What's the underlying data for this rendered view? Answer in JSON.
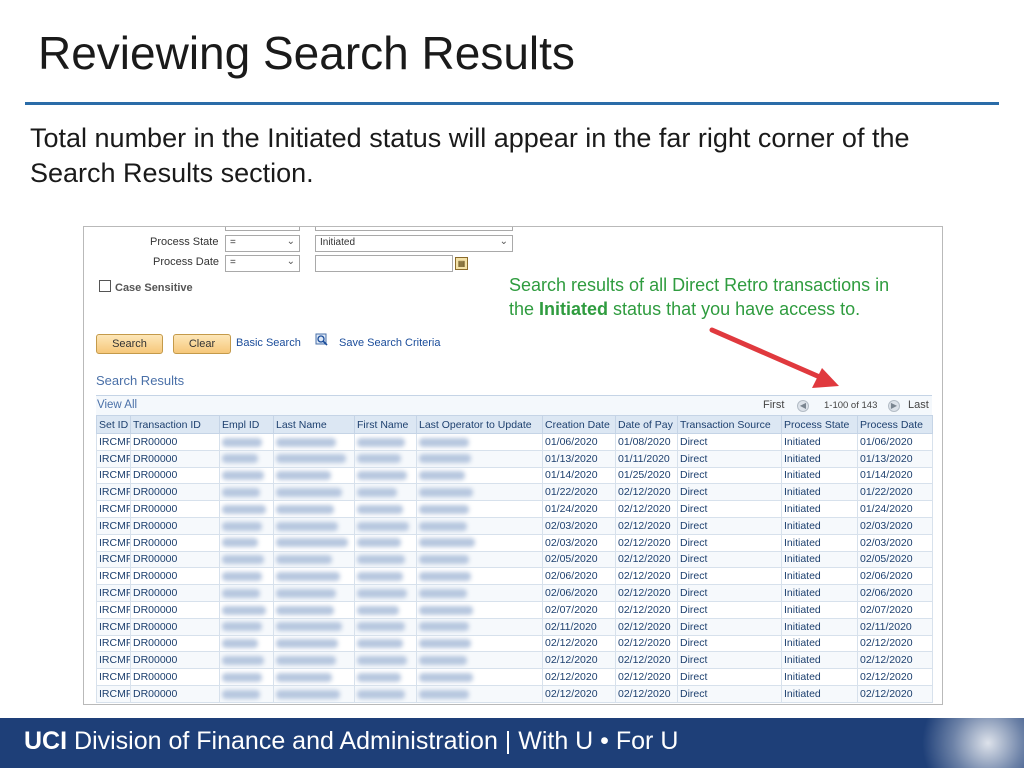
{
  "slide": {
    "title": "Reviewing Search Results",
    "body": "Total number in the Initiated status will appear in the far right corner of the Search Results section."
  },
  "criteria": {
    "process_state_label": "Process State",
    "process_state_operator": "=",
    "process_state_value": "Initiated",
    "process_date_label": "Process Date",
    "process_date_operator": "=",
    "process_date_value": "",
    "case_sensitive_label": "Case Sensitive",
    "case_sensitive_checked": false
  },
  "actions": {
    "search": "Search",
    "clear": "Clear",
    "basic_search": "Basic Search",
    "save_search_criteria": "Save Search Criteria"
  },
  "callout": {
    "before": "Search results of all Direct Retro transactions in the ",
    "highlight": "Initiated",
    "after": " status that you have access to.",
    "color": "#2f9c3f",
    "arrow_color": "#e0393e"
  },
  "results": {
    "section_title": "Search Results",
    "view_all": "View All",
    "first": "First",
    "range": "1-100 of 143",
    "last": "Last",
    "columns": [
      "Set ID",
      "Transaction ID",
      "Empl ID",
      "Last Name",
      "First Name",
      "Last Operator to Update",
      "Creation Date",
      "Date of Pay",
      "Transaction Source",
      "Process State",
      "Process Date"
    ],
    "rows": [
      [
        "IRCMP",
        "DR00000",
        "01/06/2020",
        "01/08/2020",
        "Direct",
        "Initiated",
        "01/06/2020"
      ],
      [
        "IRCMP",
        "DR00000",
        "01/13/2020",
        "01/11/2020",
        "Direct",
        "Initiated",
        "01/13/2020"
      ],
      [
        "IRCMP",
        "DR00000",
        "01/14/2020",
        "01/25/2020",
        "Direct",
        "Initiated",
        "01/14/2020"
      ],
      [
        "IRCMP",
        "DR00000",
        "01/22/2020",
        "02/12/2020",
        "Direct",
        "Initiated",
        "01/22/2020"
      ],
      [
        "IRCMP",
        "DR00000",
        "01/24/2020",
        "02/12/2020",
        "Direct",
        "Initiated",
        "01/24/2020"
      ],
      [
        "IRCMP",
        "DR00000",
        "02/03/2020",
        "02/12/2020",
        "Direct",
        "Initiated",
        "02/03/2020"
      ],
      [
        "IRCMP",
        "DR00000",
        "02/03/2020",
        "02/12/2020",
        "Direct",
        "Initiated",
        "02/03/2020"
      ],
      [
        "IRCMP",
        "DR00000",
        "02/05/2020",
        "02/12/2020",
        "Direct",
        "Initiated",
        "02/05/2020"
      ],
      [
        "IRCMP",
        "DR00000",
        "02/06/2020",
        "02/12/2020",
        "Direct",
        "Initiated",
        "02/06/2020"
      ],
      [
        "IRCMP",
        "DR00000",
        "02/06/2020",
        "02/12/2020",
        "Direct",
        "Initiated",
        "02/06/2020"
      ],
      [
        "IRCMP",
        "DR00000",
        "02/07/2020",
        "02/12/2020",
        "Direct",
        "Initiated",
        "02/07/2020"
      ],
      [
        "IRCMP",
        "DR00000",
        "02/11/2020",
        "02/12/2020",
        "Direct",
        "Initiated",
        "02/11/2020"
      ],
      [
        "IRCMP",
        "DR00000",
        "02/12/2020",
        "02/12/2020",
        "Direct",
        "Initiated",
        "02/12/2020"
      ],
      [
        "IRCMP",
        "DR00000",
        "02/12/2020",
        "02/12/2020",
        "Direct",
        "Initiated",
        "02/12/2020"
      ],
      [
        "IRCMP",
        "DR00000",
        "02/12/2020",
        "02/12/2020",
        "Direct",
        "Initiated",
        "02/12/2020"
      ],
      [
        "IRCMP",
        "DR00000",
        "02/12/2020",
        "02/12/2020",
        "Direct",
        "Initiated",
        "02/12/2020"
      ]
    ]
  },
  "footer": {
    "org": "UCI",
    "division": "Division of Finance and Administration | With U • For U",
    "color": "#1e3f78"
  },
  "colors": {
    "accent_rule": "#2a6ca8",
    "link": "#1a4c9a",
    "grid_header": "#dce7f3"
  }
}
